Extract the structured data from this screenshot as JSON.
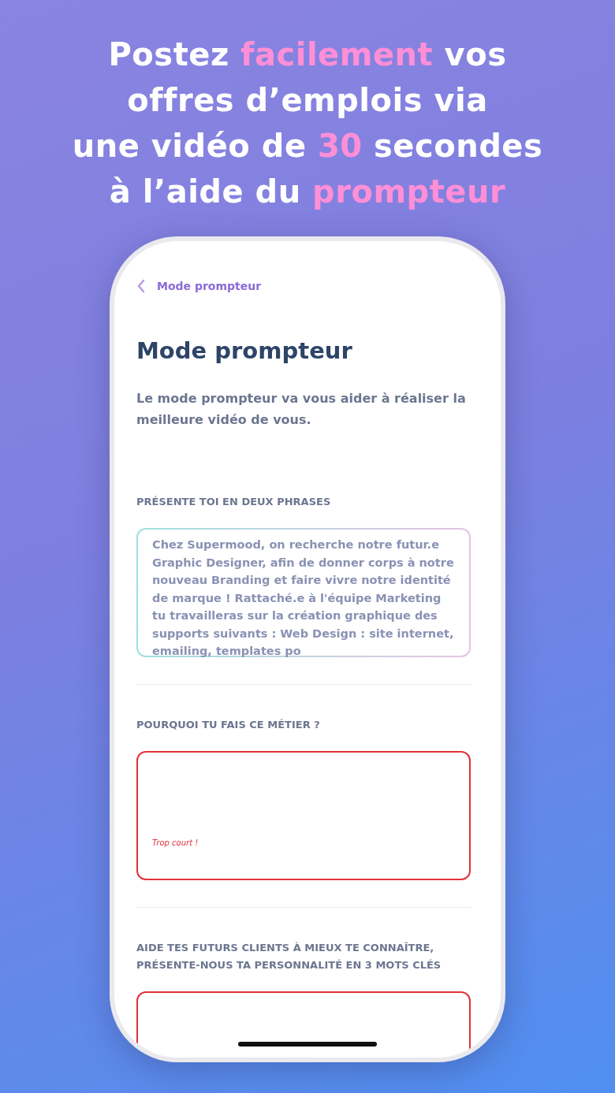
{
  "headline": [
    [
      {
        "text": "Postez ",
        "highlight": false
      },
      {
        "text": "facilement",
        "highlight": true
      },
      {
        "text": " vos",
        "highlight": false
      }
    ],
    [
      {
        "text": "offres d’emplois via",
        "highlight": false
      }
    ],
    [
      {
        "text": "une vidéo de ",
        "highlight": false
      },
      {
        "text": "30",
        "highlight": true
      },
      {
        "text": " secondes",
        "highlight": false
      }
    ],
    [
      {
        "text": "à l’aide du ",
        "highlight": false
      },
      {
        "text": "prompteur",
        "highlight": true
      }
    ]
  ],
  "nav": {
    "back_label": "Mode prompteur"
  },
  "title": "Mode prompteur",
  "description": "Le mode prompteur va vous aider à réaliser la meilleure vidéo de vous.",
  "fields": [
    {
      "label": "PRÉSENTE TOI EN DEUX PHRASES",
      "value": "Chez Supermood, on recherche notre futur.e Graphic Designer, afin de donner corps à notre nouveau Branding et faire vivre notre identité de marque !  Rattaché.e à l'équipe Marketing tu travailleras sur la création graphique des supports suivants :  Web Design : site internet, emailing, templates po",
      "invalid": false
    },
    {
      "label": "POURQUOI TU FAIS CE MÉTIER ?",
      "error": "Trop court !",
      "invalid": true
    },
    {
      "label": "AIDE TES FUTURS CLIENTS À MIEUX TE CONNAÎTRE, PRÉSENTE-NOUS TA PERSONNALITÉ EN 3 MOTS CLÉS",
      "invalid": true
    }
  ]
}
